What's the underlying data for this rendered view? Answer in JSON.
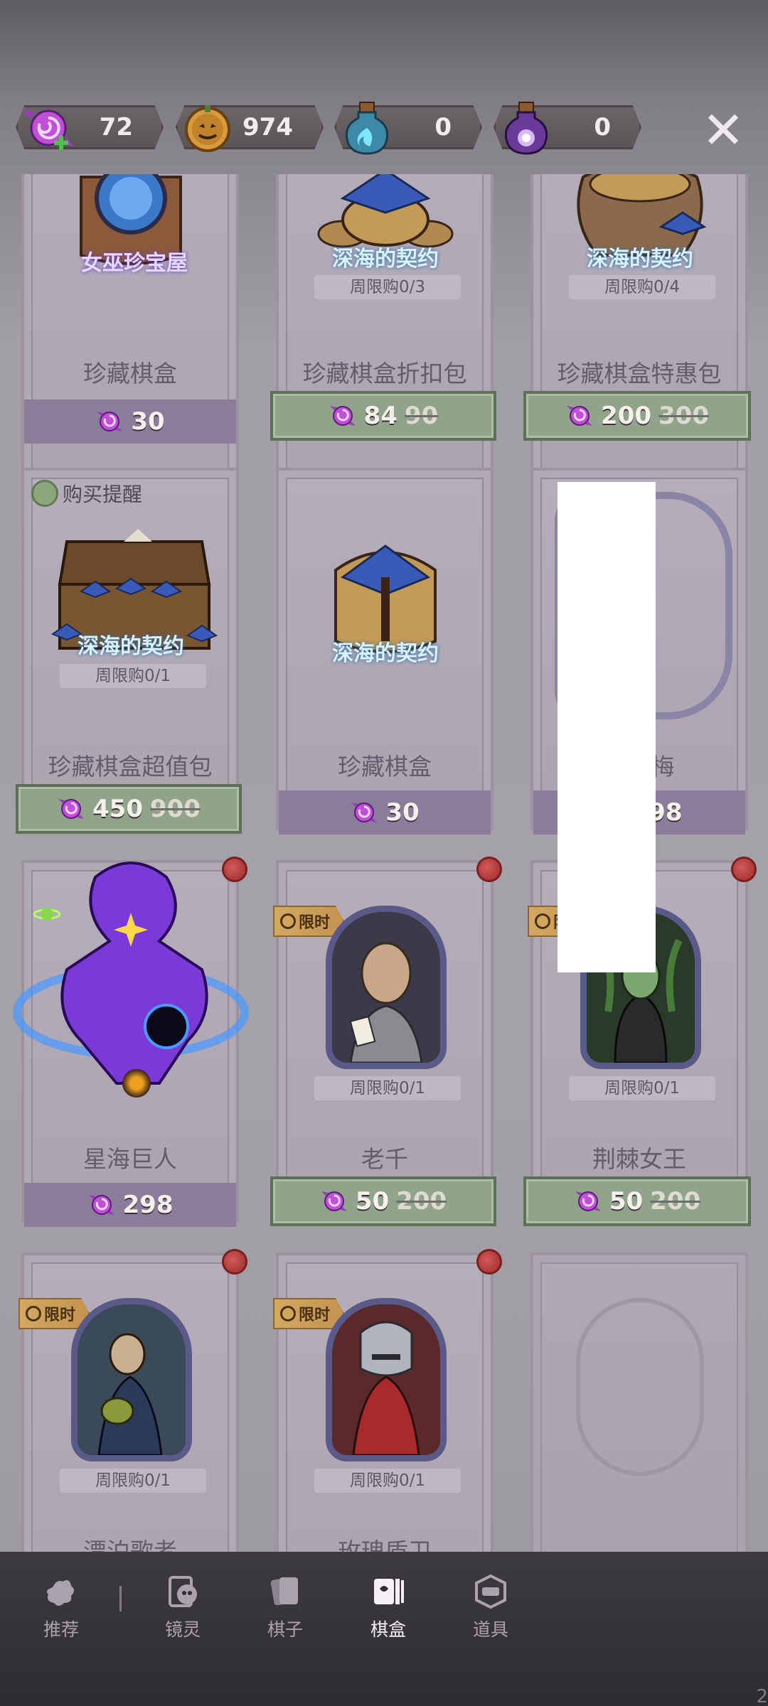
{
  "currencies": [
    {
      "icon": "candy-plus-icon",
      "value": "72"
    },
    {
      "icon": "pumpkin-coin-icon",
      "value": "974"
    },
    {
      "icon": "blue-potion-icon",
      "value": "0"
    },
    {
      "icon": "purple-potion-icon",
      "value": "0"
    }
  ],
  "close_label": "✕",
  "cards": [
    {
      "logo_text": "女巫珍宝屋",
      "name": "珍藏棋盒",
      "limit": "",
      "price": "30",
      "old_price": "",
      "style": "purple"
    },
    {
      "logo_text": "深海的契约",
      "name": "珍藏棋盒折扣包",
      "limit": "周限购0/3",
      "price": "84",
      "old_price": "90",
      "style": "green"
    },
    {
      "logo_text": "深海的契约",
      "name": "珍藏棋盒特惠包",
      "limit": "周限购0/4",
      "price": "200",
      "old_price": "300",
      "style": "green"
    },
    {
      "logo_text": "深海的契约",
      "name": "珍藏棋盒超值包",
      "limit": "周限购0/1",
      "price": "450",
      "old_price": "900",
      "style": "green",
      "reminder": "购买提醒"
    },
    {
      "logo_text": "深海的契约",
      "name": "珍藏棋盒",
      "limit": "",
      "price": "30",
      "old_price": "",
      "style": "purple"
    },
    {
      "logo_text": "",
      "name": "虎刺梅",
      "limit": "",
      "price": "298",
      "old_price": "",
      "style": "purple"
    },
    {
      "logo_text": "",
      "name": "星海巨人",
      "limit": "",
      "price": "298",
      "old_price": "",
      "style": "purple"
    },
    {
      "logo_text": "",
      "name": "老千",
      "limit": "周限购0/1",
      "price": "50",
      "old_price": "200",
      "style": "green",
      "tag": "限时"
    },
    {
      "logo_text": "",
      "name": "荆棘女王",
      "limit": "周限购0/1",
      "price": "50",
      "old_price": "200",
      "style": "green",
      "tag": "限时"
    },
    {
      "logo_text": "",
      "name": "漂泊歌者",
      "limit": "周限购0/1",
      "price": "",
      "old_price": "",
      "style": "none",
      "tag": "限时"
    },
    {
      "logo_text": "",
      "name": "玫瑰盾卫",
      "limit": "周限购0/1",
      "price": "",
      "old_price": "",
      "style": "none",
      "tag": "限时"
    }
  ],
  "nav": [
    {
      "label": "推荐",
      "icon": "recommend-icon",
      "active": false
    },
    {
      "label": "镜灵",
      "icon": "mirror-spirit-icon",
      "active": false
    },
    {
      "label": "棋子",
      "icon": "chess-piece-icon",
      "active": false
    },
    {
      "label": "棋盒",
      "icon": "chess-box-icon",
      "active": true
    },
    {
      "label": "道具",
      "icon": "item-icon",
      "active": false
    }
  ],
  "corner_number": "2",
  "colors": {
    "price_green": "#8fa48a",
    "price_purple": "#8c7c9b",
    "badge_red": "#b23a3a",
    "limited_gold": "#d2a960"
  }
}
